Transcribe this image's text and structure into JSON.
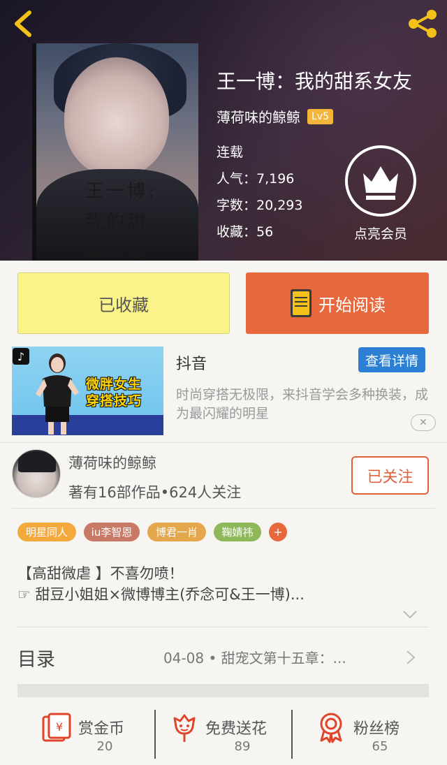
{
  "book": {
    "title": "王一博：我的甜系女友",
    "author": "薄荷味的鲸鲸",
    "level": "Lv5",
    "status": "连载",
    "popularity": "人气：7,196",
    "word_count": "字数：20,293",
    "favorites": "收藏：56",
    "cover_text": "王一博:我的甜系女友"
  },
  "member": {
    "label": "点亮会员"
  },
  "actions": {
    "favorited_label": "已收藏",
    "read_label": "开始阅读"
  },
  "ad": {
    "title": "抖音",
    "detail_button": "查看详情",
    "description": "时尚穿搭无极限，来抖音学会多种换装，成为最闪耀的明星",
    "image_caption_line1": "微胖女生",
    "image_caption_line2": "穿搭技巧",
    "close_label": "✕"
  },
  "author_card": {
    "name": "薄荷味的鲸鲸",
    "meta": "著有16部作品•624人关注",
    "follow_label": "已关注"
  },
  "tags": [
    {
      "label": "明星同人",
      "color": "#f3a93b"
    },
    {
      "label": "iu李智恩",
      "color": "#c97a66"
    },
    {
      "label": "博君一肖",
      "color": "#e4a74b"
    },
    {
      "label": "鞠婧祎",
      "color": "#8fb85a"
    }
  ],
  "tag_add": "+",
  "description": {
    "line1": "【高甜微虐 】不喜勿喷！",
    "line2": "☞ 甜豆小姐姐×微博博主(乔念可&王一博)..."
  },
  "catalog": {
    "label": "目录",
    "latest": "04-08 • 甜宠文第十五章：..."
  },
  "bottom_stats": [
    {
      "label": "赏金币",
      "value": "20"
    },
    {
      "label": "免费送花",
      "value": "89"
    },
    {
      "label": "粉丝榜",
      "value": "65"
    }
  ],
  "colors": {
    "accent": "#e8683e",
    "favorite_bg": "#f9f38a",
    "back_arrow": "#f3c21a"
  }
}
